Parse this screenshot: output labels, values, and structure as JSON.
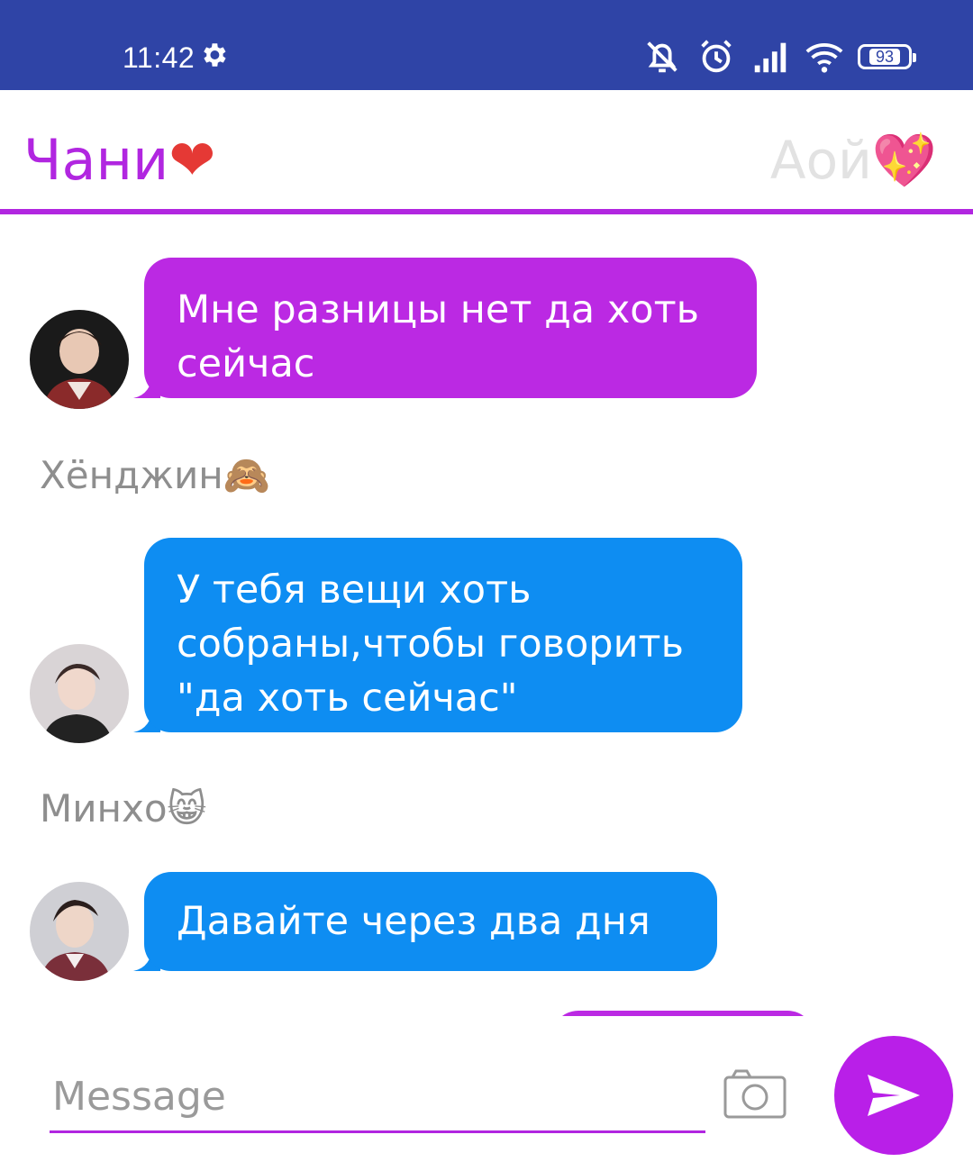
{
  "status_bar": {
    "time": "11:42",
    "battery_level": "93",
    "icons": [
      "settings-gear-icon",
      "notifications-muted-icon",
      "alarm-icon",
      "signal-icon",
      "wifi-icon",
      "battery-icon"
    ]
  },
  "header": {
    "left_name": "Чани",
    "left_emoji": "❤",
    "right_name": "Аой",
    "right_emoji": "💖",
    "accent_color": "#b126e0"
  },
  "messages": [
    {
      "text": "Мне разницы нет да хоть сейчас",
      "color": "#bb29e3"
    },
    {
      "sender": "Хёнджин🙈",
      "text": "У тебя вещи хоть собраны,чтобы говорить \"да хоть сейчас\"",
      "color": "#0e8df2"
    },
    {
      "sender": "Минхо😸",
      "text": "Давайте через два дня",
      "color": "#0e8df2"
    }
  ],
  "composer": {
    "placeholder": "Message"
  }
}
